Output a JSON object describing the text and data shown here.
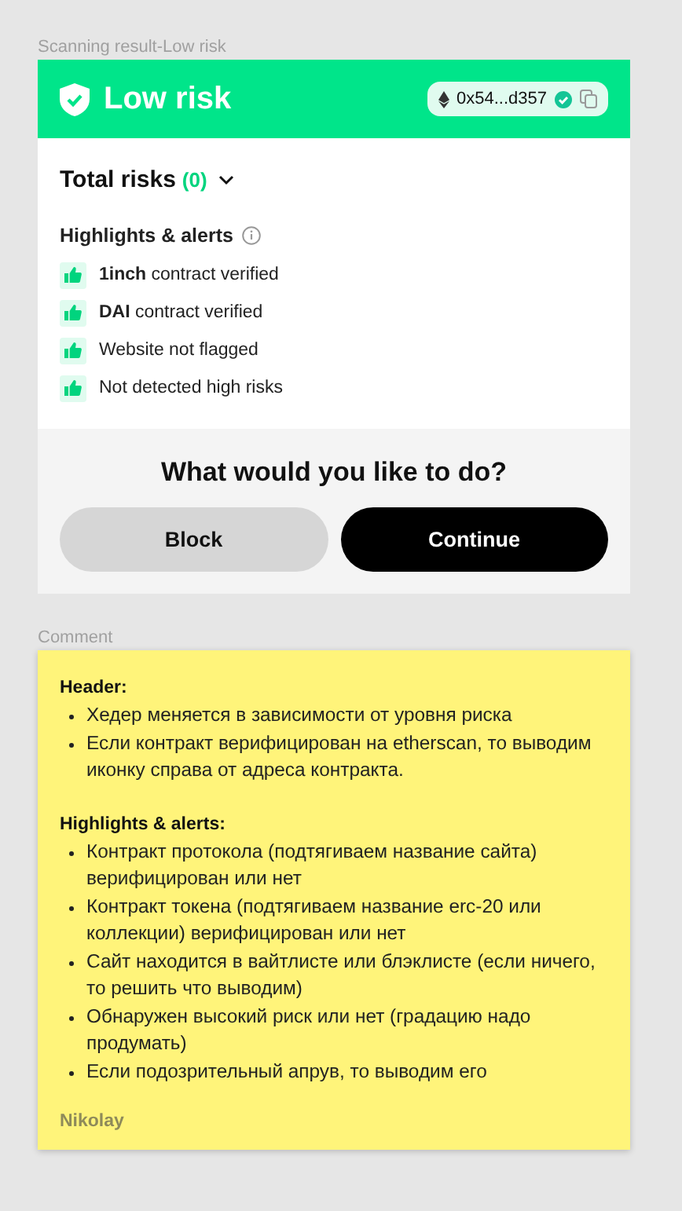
{
  "frame_label": "Scanning result-Low risk",
  "header": {
    "title": "Low risk",
    "address": "0x54...d357",
    "verified": true
  },
  "total_risks": {
    "label": "Total risks",
    "count": "(0)",
    "expanded": false
  },
  "highlights": {
    "title": "Highlights & alerts",
    "items": [
      {
        "text": "**1inch** contract verified"
      },
      {
        "text": "**DAI** contract verified"
      },
      {
        "text": "Website not flagged"
      },
      {
        "text": "Not detected high risks"
      }
    ]
  },
  "question": "What would you like to do?",
  "buttons": [
    {
      "label": "Block",
      "kind": "secondary"
    },
    {
      "label": "Continue",
      "kind": "primary"
    }
  ],
  "comment_label": "Comment",
  "comment": {
    "sections": [
      {
        "title": "Header:",
        "bullets": [
          "Хедер меняется в зависимости от уровня риска",
          "Если контракт верифицирован на etherscan, то выводим иконку справа от адреса контракта."
        ]
      },
      {
        "title": "Highlights & alerts:",
        "bullets": [
          "Контракт протокола (подтягиваем название сайта) верифицирован или нет",
          "Контракт токена (подтягиваем название erc-20 или коллекции) верифицирован или нет",
          "Сайт находится в вайтлисте или блэклисте (если ничего, то решить что выводим)",
          "Обнаружен высокий риск или нет (градацию надо продумать)",
          "Если подозрительный апрув, то выводим его"
        ]
      }
    ],
    "author": "Nikolay"
  }
}
